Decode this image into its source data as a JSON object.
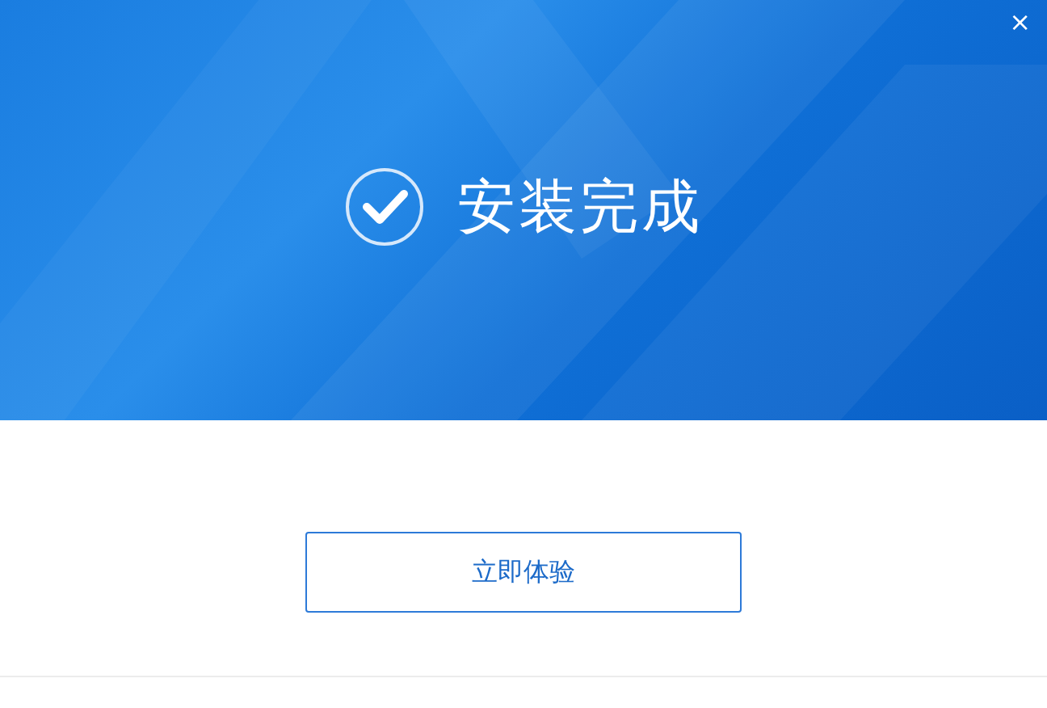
{
  "window": {
    "close": "×"
  },
  "banner": {
    "title": "安装完成"
  },
  "buttons": [
    {
      "label": "立即体验"
    }
  ]
}
